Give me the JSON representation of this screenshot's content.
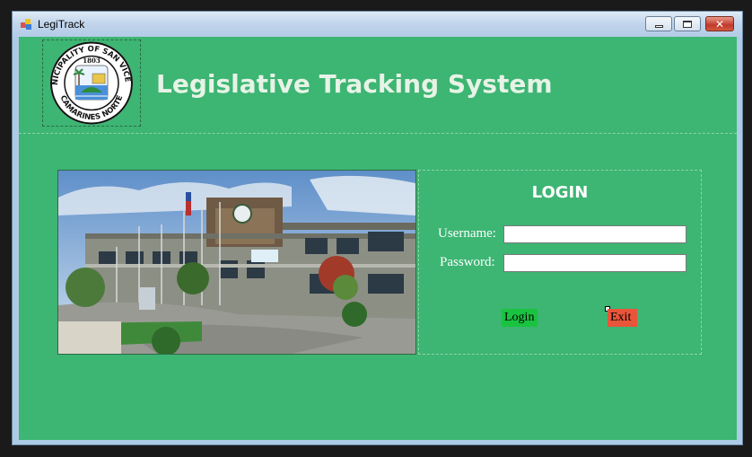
{
  "window": {
    "title": "LegiTrack"
  },
  "header": {
    "title": "Legislative Tracking System",
    "logo": {
      "top_text": "MUNICIPALITY OF SAN VICENTE",
      "bottom_text": "CAMARINES NORTE",
      "year": "1803"
    }
  },
  "login": {
    "heading": "LOGIN",
    "username_label": "Username:",
    "password_label": "Password:",
    "username_value": "",
    "password_value": "",
    "login_button": "Login",
    "exit_button": "Exit"
  },
  "colors": {
    "form_background": "#3db573",
    "login_button": "#19c340",
    "exit_button": "#e8553a",
    "title_text": "#e6f3e6"
  }
}
